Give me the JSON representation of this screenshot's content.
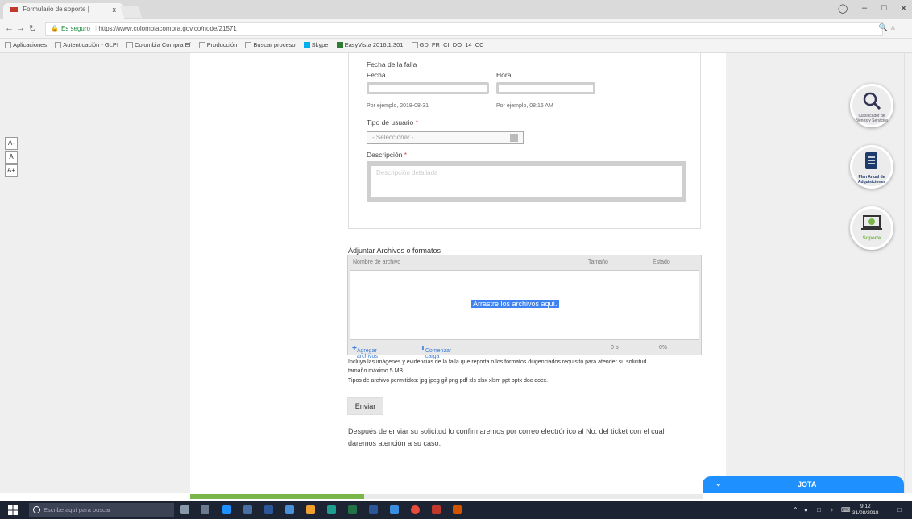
{
  "browser": {
    "tab_title": "Formulario de soporte |",
    "tab_close": "x",
    "url_secure_label": "Es seguro",
    "url": "https://www.colombiacompra.gov.co/node/21571",
    "bookmarks": [
      "Aplicaciones",
      "Autenticación - GLPI",
      "Colombia Compra Ef",
      "Producción",
      "Buscar proceso",
      "Skype",
      "EasyVista 2016.1.301",
      "GD_FR_CI_DO_14_CC"
    ]
  },
  "font_sizer": [
    "A-",
    "A",
    "A+"
  ],
  "form": {
    "section_title": "Fecha de la falla",
    "date_label": "Fecha",
    "time_label": "Hora",
    "date_hint": "Por ejemplo, 2018-08-31",
    "time_hint": "Por ejemplo, 08:16 AM",
    "user_type_label": "Tipo de usuario",
    "required_mark": "*",
    "user_type_value": "- Seleccionar -",
    "description_label": "Descripción",
    "description_placeholder": "Descripción detallada"
  },
  "attachments": {
    "title": "Adjuntar Archivos o formatos",
    "col_name": "Nombre de archivo",
    "col_size": "Tamaño",
    "col_status": "Estado",
    "drop_text": "Arrastre los archivos aquí.",
    "add_files": "Agregar archivos",
    "start_upload": "Comenzar carga",
    "total_size": "0 b",
    "total_percent": "0%",
    "note_line1": "Incluya las imágenes y evidencias de la falla que reporta o los formatos diligenciados requisito para atender su solicitud.",
    "note_line2": "tamaño máximo 5 MB",
    "note_line3": "Tipos de archivo permitidos: jpg jpeg gif png pdf xls xlsx xlsm ppt pptx doc docx."
  },
  "send_button": "Enviar",
  "after_send_text": "Después de enviar su solicitud lo confirmaremos por correo electrónico al No. del ticket con el cual daremos atención a su caso.",
  "side_buttons": [
    {
      "caption": "Clasificador de Bienes y Servicios",
      "icon": "magnifier-icon"
    },
    {
      "caption": "Plan Anual de Adquisiciones",
      "icon": "document-icon"
    },
    {
      "caption": "Soporte",
      "icon": "laptop-icon"
    }
  ],
  "chat": {
    "title": "JOTA"
  },
  "taskbar": {
    "search_placeholder": "Escribe aquí para buscar",
    "time": "9:12",
    "date": "31/08/2018"
  },
  "colors": {
    "accent_blue": "#1e90ff",
    "green_bar": "#7ab648",
    "taskbar": "#1c2433"
  }
}
